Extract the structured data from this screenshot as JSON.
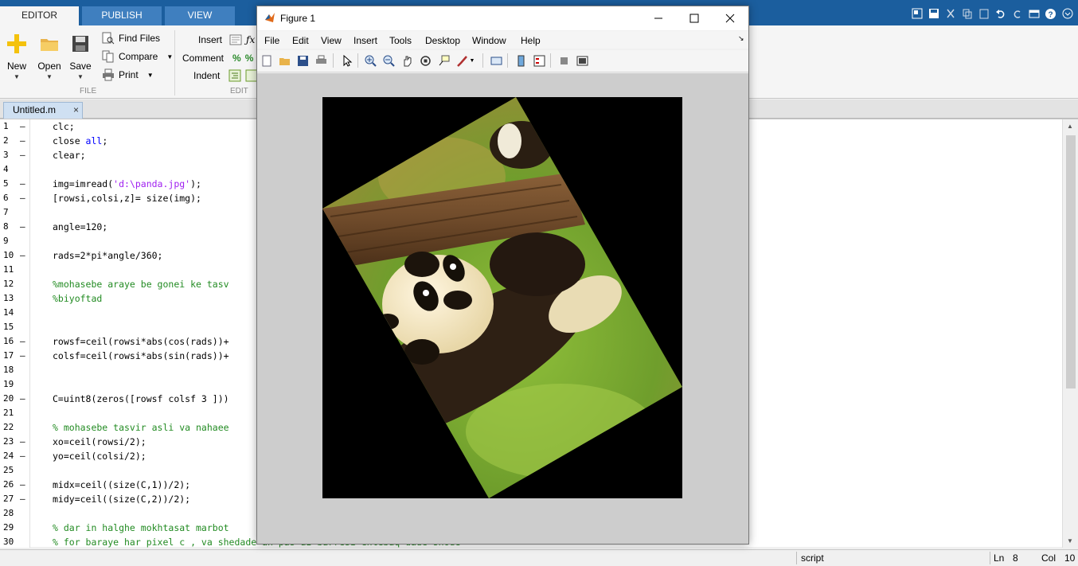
{
  "tabs": {
    "editor": "EDITOR",
    "publish": "PUBLISH",
    "view": "VIEW"
  },
  "ribbon": {
    "file": {
      "new": "New",
      "open": "Open",
      "save": "Save",
      "find_files": "Find Files",
      "compare": "Compare",
      "print": "Print",
      "section": "FILE"
    },
    "edit": {
      "insert": "Insert",
      "comment": "Comment",
      "indent": "Indent",
      "section": "EDIT"
    }
  },
  "document": {
    "tab_name": "Untitled.m",
    "close": "×"
  },
  "code_lines": [
    {
      "n": "1",
      "dash": "–",
      "text": "clc;"
    },
    {
      "n": "2",
      "dash": "–",
      "text": "close ",
      "kw": "all",
      "after": ";"
    },
    {
      "n": "3",
      "dash": "–",
      "text": "clear;"
    },
    {
      "n": "4",
      "dash": "",
      "text": ""
    },
    {
      "n": "5",
      "dash": "–",
      "text": "img=imread(",
      "str": "'d:\\panda.jpg'",
      "after": ");"
    },
    {
      "n": "6",
      "dash": "–",
      "text": "[rowsi,colsi,z]= size(img);"
    },
    {
      "n": "7",
      "dash": "",
      "text": ""
    },
    {
      "n": "8",
      "dash": "–",
      "text": "angle=120;"
    },
    {
      "n": "9",
      "dash": "",
      "text": ""
    },
    {
      "n": "10",
      "dash": "–",
      "text": "rads=2*pi*angle/360;"
    },
    {
      "n": "11",
      "dash": "",
      "text": ""
    },
    {
      "n": "12",
      "dash": "",
      "text": "%mohasebe araye be gonei ke tasv",
      "comment": true
    },
    {
      "n": "13",
      "dash": "",
      "text": "%biyoftad",
      "comment": true
    },
    {
      "n": "14",
      "dash": "",
      "text": ""
    },
    {
      "n": "15",
      "dash": "",
      "text": ""
    },
    {
      "n": "16",
      "dash": "–",
      "text": "rowsf=ceil(rowsi*abs(cos(rads))+"
    },
    {
      "n": "17",
      "dash": "–",
      "text": "colsf=ceil(rowsi*abs(sin(rads))+"
    },
    {
      "n": "18",
      "dash": "",
      "text": ""
    },
    {
      "n": "19",
      "dash": "",
      "text": ""
    },
    {
      "n": "20",
      "dash": "–",
      "text": "C=uint8(zeros([rowsf colsf 3 ]))"
    },
    {
      "n": "21",
      "dash": "",
      "text": ""
    },
    {
      "n": "22",
      "dash": "",
      "text": "% mohasebe tasvir asli va nahaee",
      "comment": true
    },
    {
      "n": "23",
      "dash": "–",
      "text": "xo=ceil(rowsi/2);"
    },
    {
      "n": "24",
      "dash": "–",
      "text": "yo=ceil(colsi/2);"
    },
    {
      "n": "25",
      "dash": "",
      "text": ""
    },
    {
      "n": "26",
      "dash": "–",
      "text": "midx=ceil((size(C,1))/2);"
    },
    {
      "n": "27",
      "dash": "–",
      "text": "midy=ceil((size(C,2))/2);"
    },
    {
      "n": "28",
      "dash": "",
      "text": ""
    },
    {
      "n": "29",
      "dash": "",
      "text": "% dar in halghe mokhtasat marbot",
      "comment": true
    },
    {
      "n": "30",
      "dash": "",
      "text": "% for baraye har pixel c , va shedade an pas az barresi entebaq dade shode",
      "comment": true
    }
  ],
  "status": {
    "mode": "script",
    "ln_label": "Ln",
    "ln": "8",
    "col_label": "Col",
    "col": "10"
  },
  "figure": {
    "title": "Figure 1",
    "menu": [
      "File",
      "Edit",
      "View",
      "Insert",
      "Tools",
      "Desktop",
      "Window",
      "Help"
    ],
    "rotation_angle": 120
  },
  "colors": {
    "tab_bar": "#1b5e9e",
    "comment": "#228b22",
    "keyword": "#0000ff",
    "string": "#a020f0",
    "canvas": "#cdcdcd"
  },
  "icons": [
    "new-script-icon",
    "open-folder-icon",
    "save-disk-icon",
    "find-files-icon",
    "compare-icon",
    "print-icon",
    "insert-icon",
    "comment-icon",
    "indent-icon",
    "figure-logo-icon",
    "pointer-icon",
    "zoom-in-icon",
    "zoom-out-icon",
    "pan-icon",
    "rotate-3d-icon",
    "data-cursor-icon",
    "brush-icon",
    "link-icon",
    "colorbar-icon",
    "legend-icon",
    "hide-plot-tools-icon",
    "show-plot-tools-icon"
  ]
}
